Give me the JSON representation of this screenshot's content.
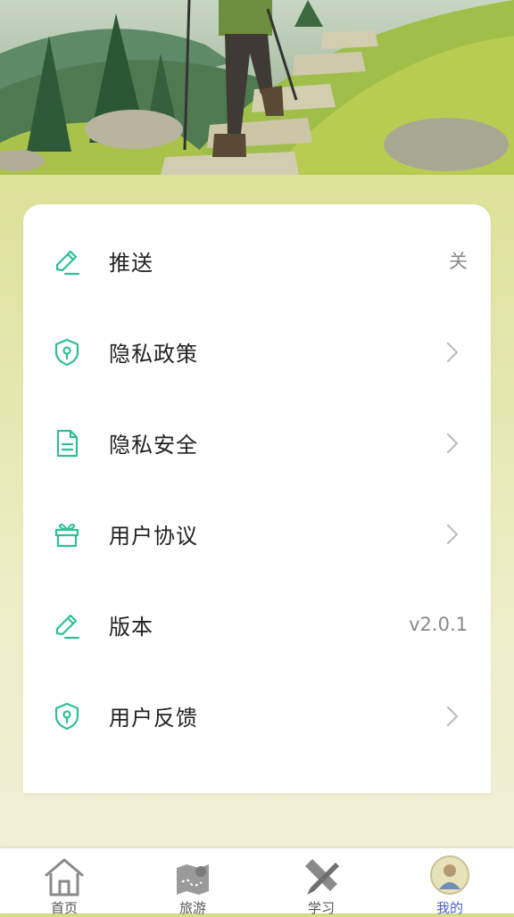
{
  "settings": {
    "items": [
      {
        "label": "推送",
        "value": "关",
        "icon": "pencil-icon"
      },
      {
        "label": "隐私政策",
        "icon": "shield-key-icon"
      },
      {
        "label": "隐私安全",
        "icon": "document-icon"
      },
      {
        "label": "用户协议",
        "icon": "gift-icon"
      },
      {
        "label": "版本",
        "value": "v2.0.1",
        "icon": "pencil-icon"
      },
      {
        "label": "用户反馈",
        "icon": "shield-key-icon"
      }
    ]
  },
  "tabbar": {
    "tabs": [
      {
        "label": "首页",
        "icon": "home-icon"
      },
      {
        "label": "旅游",
        "icon": "map-icon"
      },
      {
        "label": "学习",
        "icon": "pencil-ruler-icon"
      },
      {
        "label": "我的",
        "icon": "avatar-icon",
        "active": true
      }
    ]
  },
  "colors": {
    "accent": "#2fbf95",
    "active_tab": "#4b62c9"
  }
}
